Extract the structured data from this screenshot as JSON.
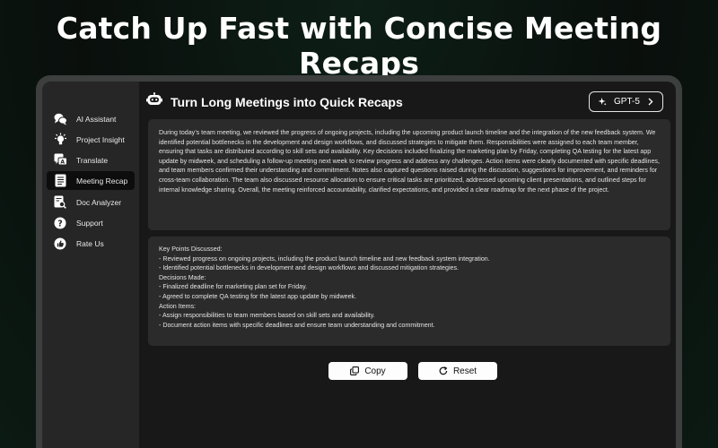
{
  "headline": "Catch Up Fast with Concise Meeting Recaps",
  "sidebar": {
    "items": [
      {
        "label": "AI Assistant",
        "icon": "chat-bubbles-icon",
        "active": false
      },
      {
        "label": "Project Insight",
        "icon": "lightbulb-icon",
        "active": false
      },
      {
        "label": "Translate",
        "icon": "translate-icon",
        "active": false
      },
      {
        "label": "Meeting Recap",
        "icon": "document-icon",
        "active": true
      },
      {
        "label": "Doc Analyzer",
        "icon": "doc-search-icon",
        "active": false
      },
      {
        "label": "Support",
        "icon": "help-icon",
        "active": false
      },
      {
        "label": "Rate Us",
        "icon": "thumbs-up-icon",
        "active": false
      }
    ]
  },
  "main": {
    "title": "Turn Long Meetings into Quick Recaps",
    "title_icon": "robot-icon",
    "model_button": {
      "label": "GPT-5",
      "icon": "sparkle-icon",
      "chevron": "chevron-right-icon"
    },
    "transcript": "During today’s team meeting, we reviewed the progress of ongoing projects, including the upcoming product launch timeline and the integration of the new feedback system. We identified potential bottlenecks in the development and design workflows, and discussed strategies to mitigate them. Responsibilities were assigned to each team member, ensuring that tasks are distributed according to skill sets and availability. Key decisions included finalizing the marketing plan by Friday, completing QA testing for the latest app update by midweek, and scheduling a follow-up meeting next week to review progress and address any challenges. Action items were clearly documented with specific deadlines, and team members confirmed their understanding and commitment. Notes also captured questions raised during the discussion, suggestions for improvement, and reminders for cross-team collaboration. The team also discussed resource allocation to ensure critical tasks are prioritized, addressed upcoming client presentations, and outlined steps for internal knowledge sharing. Overall, the meeting reinforced accountability, clarified expectations, and provided a clear roadmap for the next phase of the project.",
    "summary_lines": [
      "Key Points Discussed:",
      "- Reviewed progress on ongoing projects, including the product launch timeline and new feedback system integration.",
      "- Identified potential bottlenecks in development and design workflows and discussed mitigation strategies.",
      "Decisions Made:",
      "- Finalized deadline for marketing plan set for Friday.",
      "- Agreed to complete QA testing for the latest app update by midweek.",
      "Action Items:",
      "- Assign responsibilities to team members based on skill sets and availability.",
      "- Document action items with specific deadlines and ensure team understanding and commitment."
    ],
    "copy_label": "Copy",
    "reset_label": "Reset"
  }
}
